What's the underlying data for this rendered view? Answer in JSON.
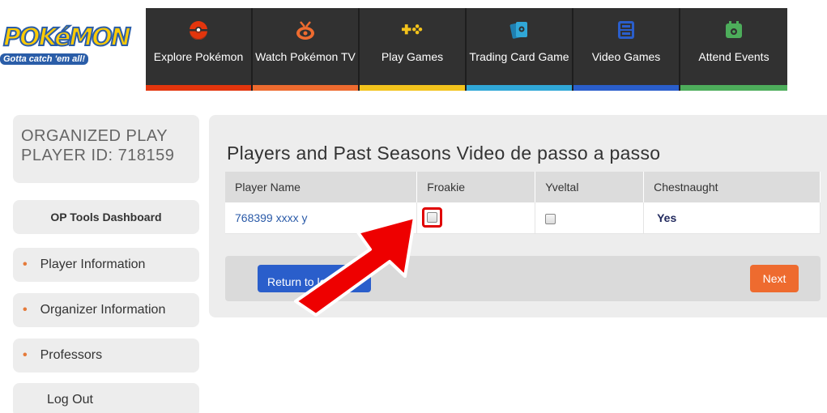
{
  "brand": {
    "logo_word": "POKéMON",
    "tagline": "Gotta catch 'em all!"
  },
  "nav": {
    "items": [
      {
        "label": "Explore Pokémon",
        "icon": "pokeball-icon",
        "bar_color": "#e3350d"
      },
      {
        "label": "Watch Pokémon TV",
        "icon": "tv-icon",
        "bar_color": "#ee6b2f"
      },
      {
        "label": "Play Games",
        "icon": "game-controller-icon",
        "bar_color": "#f3c31c"
      },
      {
        "label": "Trading Card Game",
        "icon": "cards-icon",
        "bar_color": "#30a7d7"
      },
      {
        "label": "Video Games",
        "icon": "video-game-icon",
        "bar_color": "#2a5ecb"
      },
      {
        "label": "Attend Events",
        "icon": "calendar-icon",
        "bar_color": "#4dad5b"
      }
    ]
  },
  "sidebar": {
    "op_line1": "ORGANIZED PLAY",
    "op_line2": "PLAYER ID: 718159",
    "dashboard": "OP Tools Dashboard",
    "items": [
      {
        "label": "Player Information"
      },
      {
        "label": "Organizer Information"
      },
      {
        "label": "Professors"
      }
    ],
    "logout": "Log Out"
  },
  "main": {
    "title": "Players and Past Seasons Video de passo a passo",
    "table": {
      "headers": [
        "Player Name",
        "Froakie",
        "Yveltal",
        "Chestnaught"
      ],
      "rows": [
        {
          "name": "768399 xxxx y",
          "froakie_checked": false,
          "yveltal_checked": false,
          "chestnaught": "Yes"
        }
      ]
    },
    "return_button": "Return to league",
    "next_button": "Next"
  },
  "colors": {
    "accent_orange": "#ee6b2f",
    "accent_blue": "#2a5ecb",
    "highlight_red": "#e00000"
  }
}
